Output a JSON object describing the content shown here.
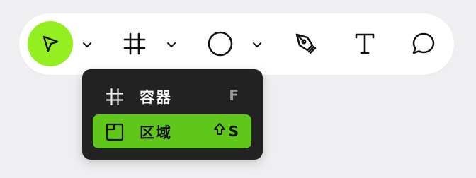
{
  "colors": {
    "accent": "#93ef1f",
    "menu_accent": "#5fc71a",
    "toolbar_bg": "#ffffff",
    "menu_bg": "#222223"
  },
  "toolbar": {
    "tools": [
      {
        "icon": "pointer-arrow-icon",
        "active": true
      },
      {
        "icon": "frame-hash-icon",
        "active": false
      },
      {
        "icon": "circle-shape-icon",
        "active": false
      },
      {
        "icon": "pen-nib-icon",
        "active": false
      },
      {
        "icon": "text-t-icon",
        "active": false
      },
      {
        "icon": "comment-bubble-icon",
        "active": false
      }
    ]
  },
  "frame_menu": {
    "items": [
      {
        "icon": "frame-hash-icon",
        "label": "容器",
        "shortcut": "F",
        "selected": false
      },
      {
        "icon": "section-panel-icon",
        "label": "区域",
        "shortcut_modifier_icon": "shift-arrow-icon",
        "shortcut": "S",
        "selected": true
      }
    ]
  }
}
